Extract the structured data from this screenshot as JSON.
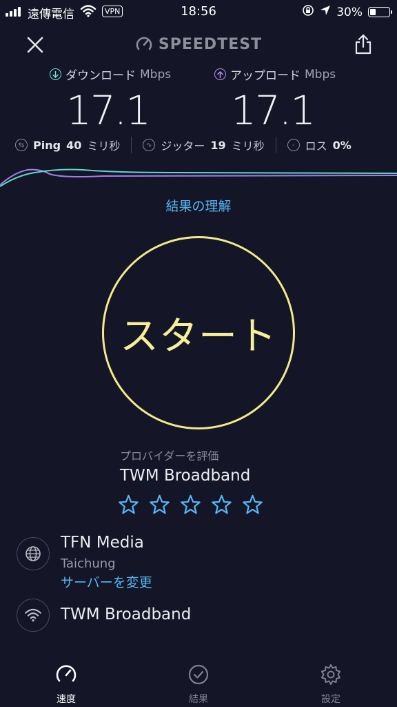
{
  "status_bar": {
    "carrier": "遠傳電信",
    "vpn": "VPN",
    "time": "18:56",
    "battery": "30%",
    "battery_level": 0.3
  },
  "header": {
    "logo": "SPEEDTEST"
  },
  "download": {
    "label": "ダウンロード",
    "unit": "Mbps",
    "value": "17.1",
    "color": "#6ee3d8"
  },
  "upload": {
    "label": "アップロード",
    "unit": "Mbps",
    "value": "17.1",
    "color": "#b48cf0"
  },
  "stats": {
    "ping_label": "Ping",
    "ping_value": "40",
    "ping_unit": "ミリ秒",
    "jitter_label": "ジッター",
    "jitter_value": "19",
    "jitter_unit": "ミリ秒",
    "loss_label": "ロス",
    "loss_value": "0%"
  },
  "understand_link": "結果の理解",
  "start_button": "スタート",
  "rating": {
    "label": "プロバイダーを評価",
    "provider": "TWM Broadband",
    "stars_filled": 0
  },
  "server": {
    "name": "TFN Media",
    "location": "Taichung",
    "change": "サーバーを変更"
  },
  "connection": {
    "provider": "TWM Broadband"
  },
  "tabs": [
    {
      "label": "速度",
      "icon": "speedometer-icon",
      "active": true
    },
    {
      "label": "結果",
      "icon": "check-circle-icon",
      "active": false
    },
    {
      "label": "設定",
      "icon": "gear-icon",
      "active": false
    }
  ],
  "colors": {
    "background": "#141527",
    "accent_link": "#55b8f2",
    "start_ring": "#f2ea8a"
  }
}
